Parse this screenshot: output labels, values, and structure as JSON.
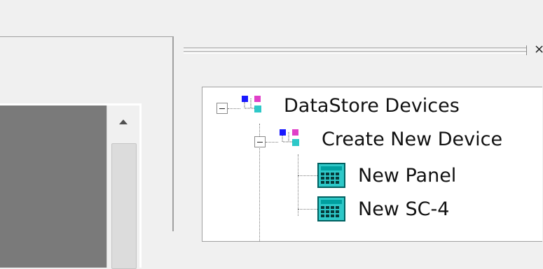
{
  "panel": {
    "close_glyph": "×"
  },
  "tree": {
    "root": {
      "label": "DataStore Devices",
      "icon": "device-group-icon",
      "expanded": true,
      "children": [
        {
          "label": "Create New Device",
          "icon": "device-group-icon",
          "expanded": true,
          "children": [
            {
              "label": "New Panel",
              "icon": "panel-device-icon"
            },
            {
              "label": "New SC-4",
              "icon": "panel-device-icon"
            }
          ]
        }
      ]
    }
  },
  "colors": {
    "window_bg": "#f0f0f0",
    "tree_bg": "#ffffff",
    "dark_panel": "#7a7a7a",
    "icon_blue": "#1a1aff",
    "icon_magenta": "#e040c8",
    "icon_cyan": "#2ec8c8",
    "icon_teal": "#00a0a0"
  }
}
